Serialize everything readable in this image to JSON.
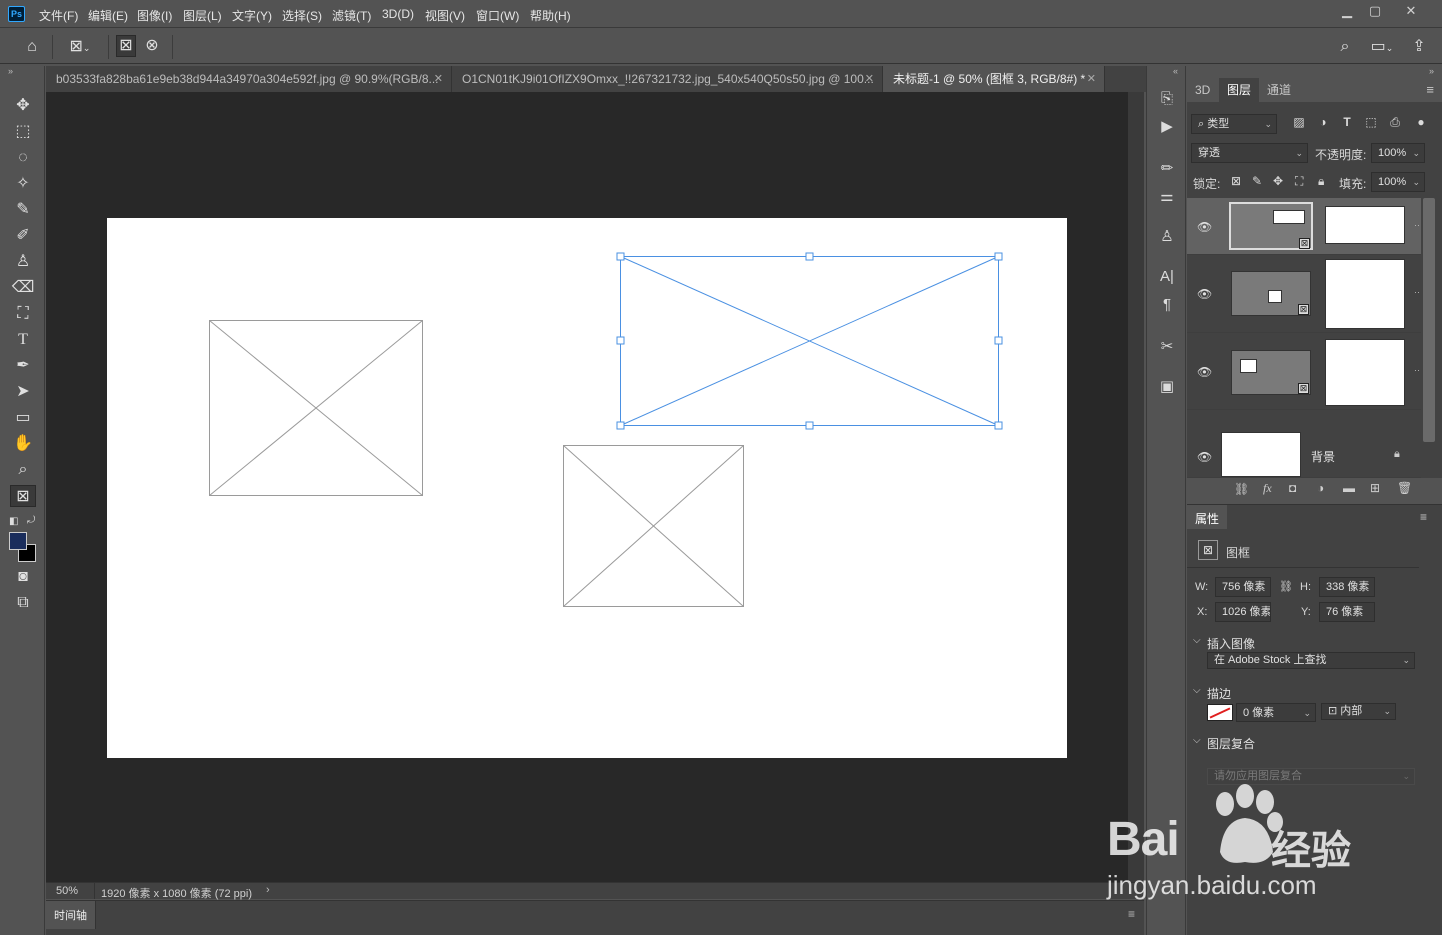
{
  "app": {
    "logo": "Ps",
    "accent_color": "#31a8ff",
    "canvas_color": "#ffffff",
    "selection_color": "#4a90e2"
  },
  "menubar": {
    "items": [
      "文件(F)",
      "编辑(E)",
      "图像(I)",
      "图层(L)",
      "文字(Y)",
      "选择(S)",
      "滤镜(T)",
      "3D(D)",
      "视图(V)",
      "窗口(W)",
      "帮助(H)"
    ],
    "window_buttons": [
      "minimize-icon",
      "restore-icon",
      "close-icon"
    ]
  },
  "options_bar": {
    "icons": [
      "home-icon",
      "frame-tool-icon",
      "rectangle-frame-icon",
      "ellipse-frame-icon",
      "search-icon",
      "workspace-icon",
      "share-icon"
    ]
  },
  "tabs": [
    {
      "label": "b03533fa828ba61e9eb38d944a34970a304e592f.jpg @ 90.9%(RGB/8...",
      "active": false
    },
    {
      "label": "O1CN01tKJ9i01OfIZX9Omxx_!!267321732.jpg_540x540Q50s50.jpg @ 100...",
      "active": false
    },
    {
      "label": "未标题-1 @ 50% (图框 3, RGB/8#) *",
      "active": true
    }
  ],
  "status": {
    "zoom": "50%",
    "doc_info": "1920 像素 x 1080 像素 (72 ppi)"
  },
  "timeline": {
    "label": "时间轴"
  },
  "layers_panel": {
    "tabs": [
      "3D",
      "图层",
      "通道"
    ],
    "active_tab": "图层",
    "filter_label": "类型",
    "blend_mode": "穿透",
    "opacity_label": "不透明度:",
    "opacity_value": "100%",
    "lock_label": "锁定:",
    "fill_label": "填充:",
    "fill_value": "100%",
    "layers": [
      {
        "name": "",
        "type": "frame",
        "selected": true
      },
      {
        "name": "",
        "type": "frame",
        "selected": false
      },
      {
        "name": "",
        "type": "frame",
        "selected": false
      },
      {
        "name": "背景",
        "type": "background",
        "selected": false
      }
    ]
  },
  "properties_panel": {
    "tab": "属性",
    "kind": "图框",
    "w_label": "W:",
    "w_value": "756 像素",
    "h_label": "H:",
    "h_value": "338 像素",
    "x_label": "X:",
    "x_value": "1026 像素",
    "y_label": "Y:",
    "y_value": "76 像素",
    "insert_image_title": "插入图像",
    "insert_image_value": "在 Adobe Stock 上查找",
    "stroke_title": "描边",
    "stroke_width": "0 像素",
    "stroke_position": "内部",
    "layer_comp_title": "图层复合",
    "layer_comp_value": "请勿应用图层复合"
  },
  "watermark": {
    "brand": "Bai",
    "brand_cn": "经验",
    "url": "jingyan.baidu.com"
  }
}
